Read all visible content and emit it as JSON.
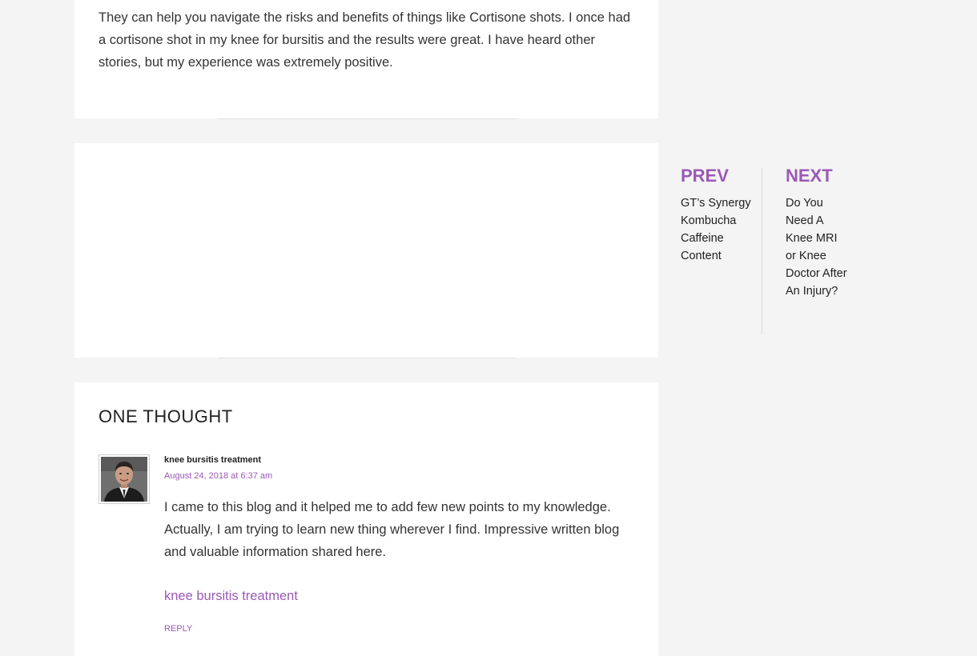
{
  "article": {
    "paragraph": "They can help you navigate the risks and benefits of things like Cortisone shots. I once had a cortisone shot in my knee for bursitis and the results were great. I have heard other stories, but my experience was extremely positive."
  },
  "comments": {
    "title": "ONE THOUGHT",
    "items": [
      {
        "author": "knee bursitis treatment",
        "date": "August 24, 2018 at 6:37 am",
        "text": "I came to this blog and it helped me to add few new points to my knowledge. Actually, I am trying to learn new thing wherever I find. Impressive written blog and valuable information shared here.",
        "link_text": "knee bursitis treatment",
        "reply_label": "REPLY"
      }
    ]
  },
  "post_nav": {
    "prev_label": "PREV",
    "prev_title": "GT’s Synergy Kombucha Caffeine Content",
    "next_label": "NEXT",
    "next_title": "Do You Need A Knee MRI or Knee Doctor After An Injury?"
  },
  "colors": {
    "accent": "#9b59b6",
    "background": "#f4f4f4",
    "card": "#ffffff"
  },
  "icons": {
    "avatar": "user-avatar-photo"
  }
}
